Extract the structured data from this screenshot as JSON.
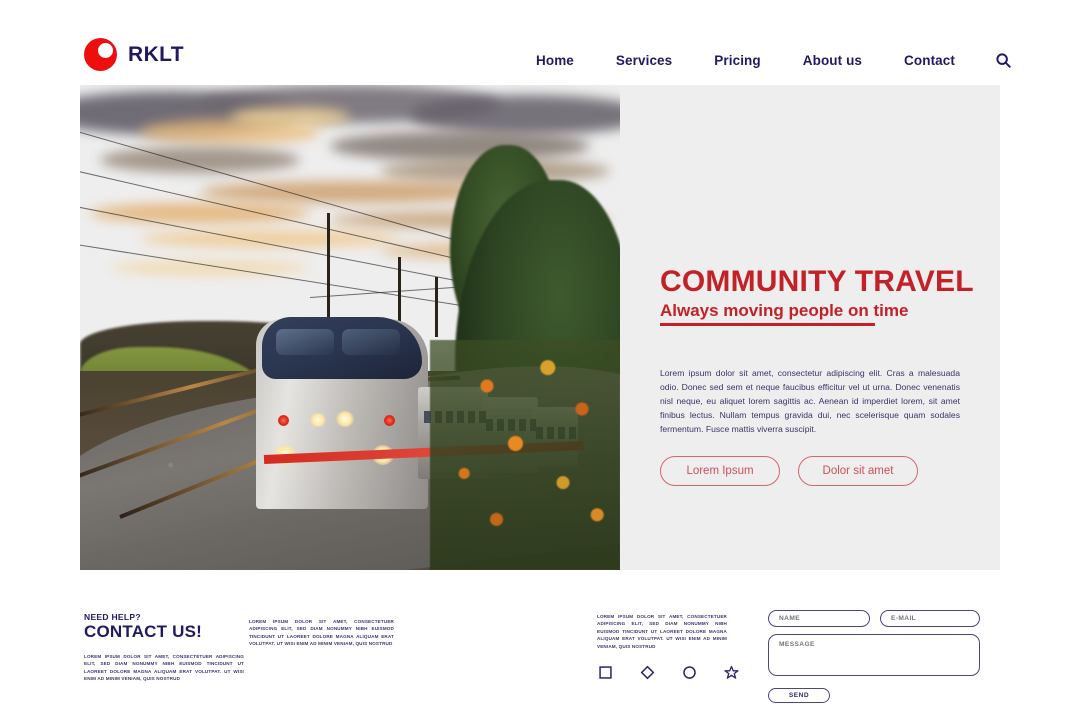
{
  "brand": {
    "name": "RKLT",
    "logo_icon": "circle-cutout-logo-icon",
    "logo_color": "#ee0e0e",
    "text_color": "#201a63"
  },
  "nav": {
    "items": [
      {
        "label": "Home"
      },
      {
        "label": "Services"
      },
      {
        "label": "Pricing"
      },
      {
        "label": "About us"
      },
      {
        "label": "Contact"
      }
    ],
    "search_icon": "search-icon"
  },
  "hero": {
    "title": "COMMUNITY TRAVEL",
    "subtitle": "Always moving people on time",
    "accent_color": "#c32128",
    "panel_color": "#eeeeee",
    "body": "Lorem ipsum dolor sit amet, consectetur adipiscing elit. Cras a malesuada odio. Donec sed sem et neque faucibus efficitur vel ut urna. Donec venenatis nisl neque, eu aliquet lorem sagittis ac. Aenean id imperdiet lorem, sit amet finibus lectus. Nullam tempus gravida dui, nec scelerisque quam sodales fermentum. Fusce mattis viverra suscipit.",
    "buttons": [
      {
        "label": "Lorem Ipsum"
      },
      {
        "label": "Dolor sit amet"
      }
    ],
    "photo_alt": "Passenger train on curving railroad tracks at sunset with orange clouds, trees and wildflowers"
  },
  "footer": {
    "need_help": "NEED HELP?",
    "contact_us": "CONTACT US!",
    "lorem_block": "LOREM IPSUM DOLOR SIT AMET, CONSECTETUER ADIPISCING ELIT, SED DIAM NONUMMY NIBH EUISMOD TINCIDUNT UT LAOREET DOLORE MAGNA ALIQUAM ERAT VOLUTPAT. UT WISI ENIM AD MINIM VENIAM, QUIS NOSTRUD",
    "socials": [
      {
        "icon": "square-icon"
      },
      {
        "icon": "diamond-icon"
      },
      {
        "icon": "circle-icon"
      },
      {
        "icon": "star-icon"
      }
    ],
    "form": {
      "name_placeholder": "NAME",
      "email_placeholder": "E-MAIL",
      "message_placeholder": "MESSAGE",
      "send_label": "SEND"
    }
  }
}
